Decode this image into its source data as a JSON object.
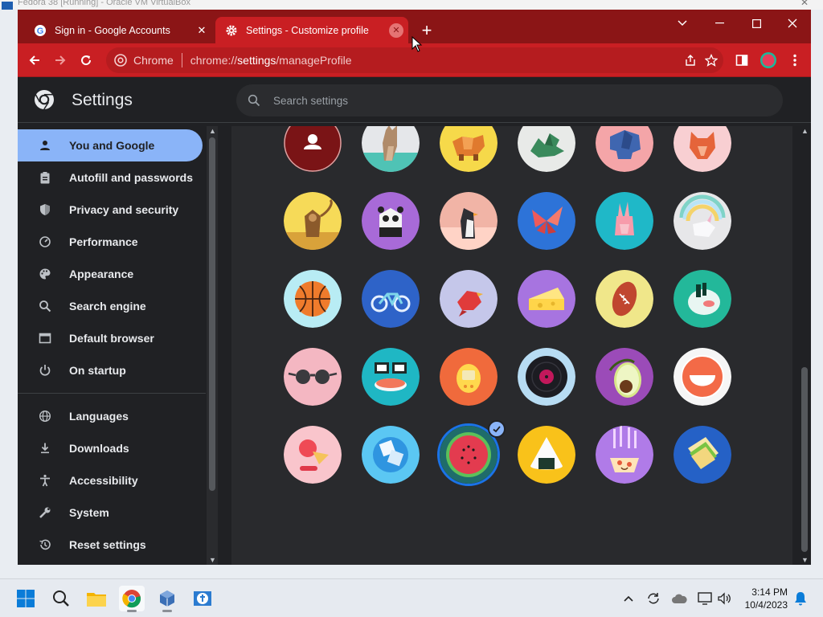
{
  "host": {
    "title": "Fedora 38 [Running] - Oracle VM VirtualBox"
  },
  "tabs": [
    {
      "title": "Sign in - Google Accounts",
      "icon": "google-g-icon",
      "active": false
    },
    {
      "title": "Settings - Customize profile",
      "icon": "gear-icon",
      "active": true
    }
  ],
  "toolbar": {
    "chip_label": "Chrome",
    "url_scheme": "chrome://",
    "url_host": "settings",
    "url_path": "/manageProfile"
  },
  "settings": {
    "title": "Settings",
    "search_placeholder": "Search settings"
  },
  "sidebar": {
    "items": [
      {
        "label": "You and Google",
        "icon": "person-icon",
        "selected": true
      },
      {
        "label": "Autofill and passwords",
        "icon": "clipboard-icon"
      },
      {
        "label": "Privacy and security",
        "icon": "shield-icon"
      },
      {
        "label": "Performance",
        "icon": "speedometer-icon"
      },
      {
        "label": "Appearance",
        "icon": "palette-icon"
      },
      {
        "label": "Search engine",
        "icon": "search-icon"
      },
      {
        "label": "Default browser",
        "icon": "browser-window-icon"
      },
      {
        "label": "On startup",
        "icon": "power-icon"
      },
      {
        "label": "Languages",
        "icon": "globe-icon"
      },
      {
        "label": "Downloads",
        "icon": "download-icon"
      },
      {
        "label": "Accessibility",
        "icon": "accessibility-icon"
      },
      {
        "label": "System",
        "icon": "wrench-icon"
      },
      {
        "label": "Reset settings",
        "icon": "history-icon"
      }
    ]
  },
  "avatars": [
    "person",
    "cat",
    "fox-dog",
    "dragon",
    "elephant",
    "fox",
    "monkey",
    "panda",
    "penguin",
    "butterfly",
    "rabbit",
    "unicorn",
    "basketball",
    "bicycle",
    "bird",
    "cheese",
    "football",
    "sushi-bowl",
    "sunglasses",
    "sushi",
    "tamagotchi",
    "vinyl",
    "avocado",
    "smile",
    "ice-cream",
    "box",
    "watermelon",
    "onigiri",
    "pizza",
    "sandwich"
  ],
  "selected_avatar": "watermelon",
  "colors": {
    "tab_strip": "#8b1516",
    "toolbar": "#c91f23",
    "accent": "#8ab4f8"
  },
  "taskbar": {
    "apps": [
      "windows-start-icon",
      "search-icon",
      "file-explorer-icon",
      "chrome-icon",
      "virtualbox-icon",
      "fedora-vm-icon"
    ],
    "time": "3:14 PM",
    "date": "10/4/2023"
  }
}
